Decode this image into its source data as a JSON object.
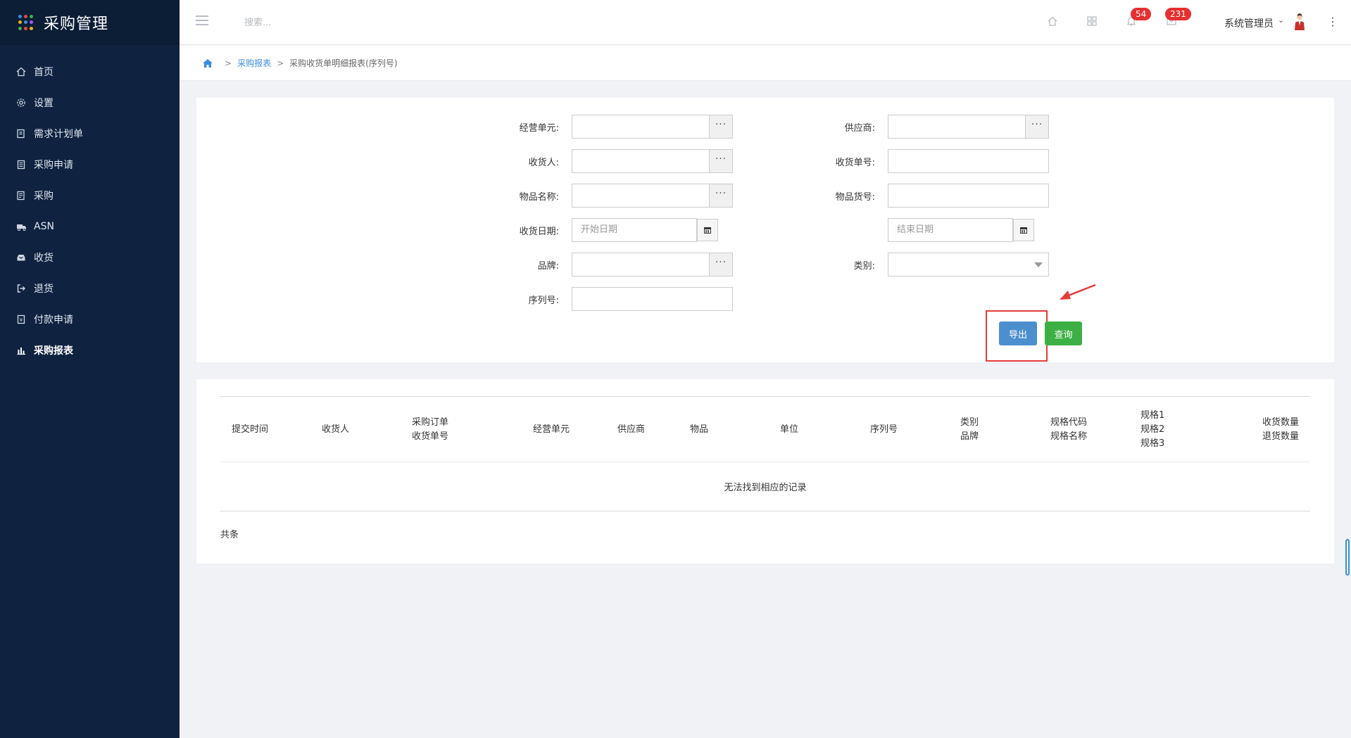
{
  "app": {
    "title": "采购管理",
    "brand_dot_colors": [
      "#3c8dde",
      "#e64a3c",
      "#3db045",
      "#f0ad1e",
      "#3c8dde",
      "#a855f7",
      "#3db045",
      "#e64a3c",
      "#f0ad1e"
    ]
  },
  "sidebar": {
    "items": [
      {
        "label": "首页",
        "icon": "home-icon"
      },
      {
        "label": "设置",
        "icon": "gear-icon"
      },
      {
        "label": "需求计划单",
        "icon": "document-edit-icon"
      },
      {
        "label": "采购申请",
        "icon": "clipboard-icon"
      },
      {
        "label": "采购",
        "icon": "list-document-icon"
      },
      {
        "label": "ASN",
        "icon": "truck-icon"
      },
      {
        "label": "收货",
        "icon": "inbox-icon"
      },
      {
        "label": "退货",
        "icon": "sign-out-icon"
      },
      {
        "label": "付款申请",
        "icon": "receipt-icon"
      },
      {
        "label": "采购报表",
        "icon": "bar-chart-icon",
        "active": true
      }
    ]
  },
  "topbar": {
    "search_placeholder": "搜索...",
    "notifications_count": "54",
    "messages_count": "231",
    "user_name": "系统管理员"
  },
  "breadcrumb": {
    "parent": "采购报表",
    "current": "采购收货单明细报表(序列号)"
  },
  "form": {
    "business_unit_label": "经营单元:",
    "supplier_label": "供应商:",
    "receiver_label": "收货人:",
    "receipt_no_label": "收货单号:",
    "item_name_label": "物品名称:",
    "item_code_label": "物品货号:",
    "receipt_date_label": "收货日期:",
    "start_date_placeholder": "开始日期",
    "end_date_placeholder": "结束日期",
    "brand_label": "品牌:",
    "category_label": "类别:",
    "serial_no_label": "序列号:",
    "export_label": "导出",
    "query_label": "查询"
  },
  "table": {
    "columns": [
      [
        "提交时间"
      ],
      [
        "收货人"
      ],
      [
        "采购订单",
        "收货单号"
      ],
      [
        "经营单元"
      ],
      [
        "供应商"
      ],
      [
        "物品"
      ],
      [
        "单位"
      ],
      [
        "序列号"
      ],
      [
        "类别",
        "品牌"
      ],
      [
        "规格代码",
        "规格名称"
      ],
      [
        "规格1",
        "规格2",
        "规格3"
      ],
      [
        "收货数量",
        "退货数量"
      ]
    ],
    "empty_message": "无法找到相应的记录",
    "footer": "共条"
  },
  "colors": {
    "sidebar_bg": "#0f2340",
    "primary_blue": "#4c8fcf",
    "query_green": "#3db045",
    "badge_red": "#e62f2f",
    "annotation_red": "#e43b3b"
  }
}
